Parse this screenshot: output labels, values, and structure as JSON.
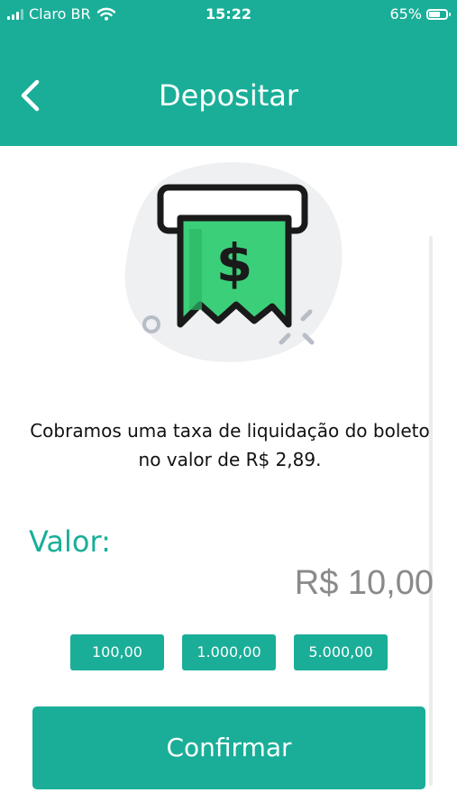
{
  "status_bar": {
    "carrier": "Claro BR",
    "time": "15:22",
    "battery": "65%",
    "battery_level": 0.65
  },
  "header": {
    "title": "Depositar",
    "back_icon": "chevron-left-icon"
  },
  "illustration": {
    "icon": "boleto-receipt-dollar-icon",
    "symbol": "$"
  },
  "notice": {
    "text": "Cobramos uma taxa de liquidação do boleto no valor de R$ 2,89."
  },
  "form": {
    "label": "Valor:",
    "amount": "R$ 10,00"
  },
  "quick_amounts": [
    "100,00",
    "1.000,00",
    "5.000,00"
  ],
  "confirm_label": "Confirmar",
  "colors": {
    "primary": "#1aae98",
    "amount_text": "#8a8a8a",
    "receipt_green": "#3ccf7a"
  }
}
